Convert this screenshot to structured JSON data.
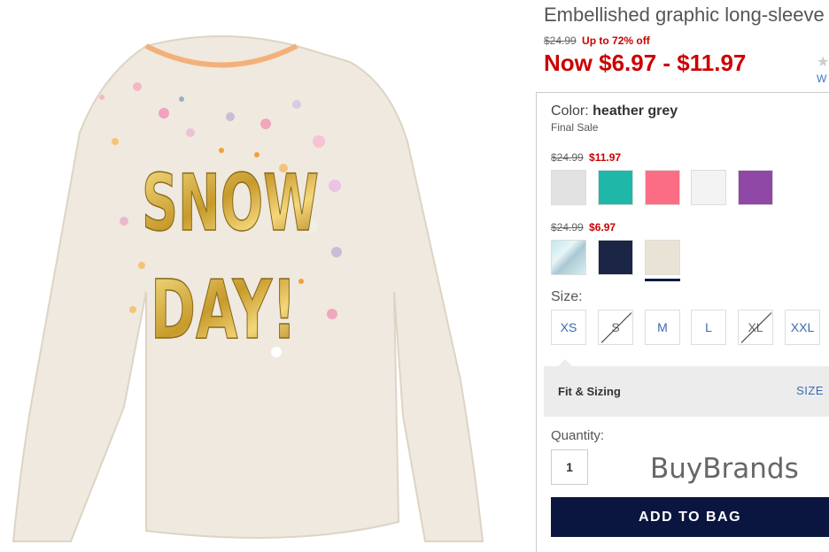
{
  "product": {
    "title": "Embellished graphic long-sleeve tee",
    "original_price": "$24.99",
    "discount_text": "Up to 72% off",
    "now_price": "Now $6.97 - $11.97",
    "review_link": "W",
    "star_icon": "star-icon"
  },
  "image": {
    "graphic_text_line1": "SNOW",
    "graphic_text_line2": "DAY!"
  },
  "color": {
    "label": "Color:",
    "selected": "heather grey",
    "note": "Final Sale",
    "groups": [
      {
        "original_price": "$24.99",
        "sale_price": "$11.97",
        "swatches": [
          {
            "name": "light grey",
            "color": "#e2e2e2"
          },
          {
            "name": "teal",
            "color": "#1fb8a8"
          },
          {
            "name": "pink",
            "color": "#fb6d84"
          },
          {
            "name": "white",
            "color": "#f3f3f3"
          },
          {
            "name": "purple",
            "color": "#9048a6"
          }
        ]
      },
      {
        "original_price": "$24.99",
        "sale_price": "$6.97",
        "swatches": [
          {
            "name": "snow print",
            "color": "#bfe6ec"
          },
          {
            "name": "navy",
            "color": "#1b2647"
          },
          {
            "name": "heather grey",
            "color": "#e9e3d6"
          }
        ]
      }
    ]
  },
  "size": {
    "label": "Size:",
    "options": [
      {
        "label": "XS",
        "available": true
      },
      {
        "label": "S",
        "available": false
      },
      {
        "label": "M",
        "available": true
      },
      {
        "label": "L",
        "available": true
      },
      {
        "label": "XL",
        "available": false
      },
      {
        "label": "XXL",
        "available": true
      }
    ]
  },
  "fit": {
    "title": "Fit & Sizing",
    "size_chart_link": "SIZE"
  },
  "quantity": {
    "label": "Quantity:",
    "value": "1"
  },
  "watermark": "BuyBrands",
  "cart": {
    "add_label": "ADD TO BAG"
  },
  "colors": {
    "sale_red": "#cc0000",
    "navy": "#0b1640",
    "link_blue": "#3a6ab0"
  }
}
